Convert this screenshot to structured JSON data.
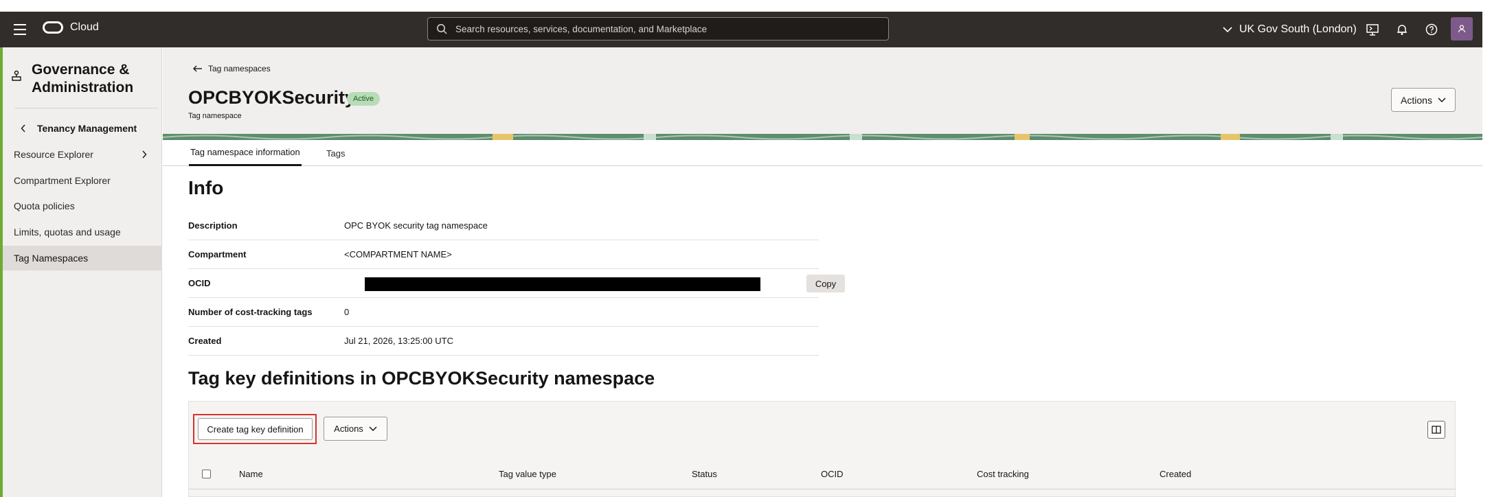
{
  "header": {
    "brand": "Cloud",
    "search_placeholder": "Search resources, services, documentation, and Marketplace",
    "region": "UK Gov South (London)"
  },
  "sidebar": {
    "title": "Governance & Administration",
    "back_label": "Tenancy Management",
    "items": [
      {
        "label": "Resource Explorer"
      },
      {
        "label": "Compartment Explorer"
      },
      {
        "label": "Quota policies"
      },
      {
        "label": "Limits, quotas and usage"
      },
      {
        "label": "Tag Namespaces"
      }
    ]
  },
  "page": {
    "back_link": "Tag namespaces",
    "title": "OPCBYOKSecurity",
    "status": "Active",
    "subtitle": "Tag namespace",
    "actions_label": "Actions"
  },
  "tabs": [
    {
      "label": "Tag namespace information"
    },
    {
      "label": "Tags"
    }
  ],
  "info": {
    "heading": "Info",
    "rows": [
      {
        "label": "Description",
        "value": "OPC BYOK security tag namespace"
      },
      {
        "label": "Compartment",
        "value": "<COMPARTMENT NAME>"
      },
      {
        "label": "OCID",
        "value": ""
      },
      {
        "label": "Number of cost-tracking tags",
        "value": "0"
      },
      {
        "label": "Created",
        "value": "Jul 21, 2026, 13:25:00 UTC"
      }
    ],
    "copy_label": "Copy"
  },
  "tag_keys": {
    "heading": "Tag key definitions in OPCBYOKSecurity namespace",
    "create_label": "Create tag key definition",
    "actions_label": "Actions",
    "columns": [
      "Name",
      "Tag value type",
      "Status",
      "OCID",
      "Cost tracking",
      "Created"
    ]
  },
  "colors": {
    "header_bg": "#312d2a",
    "accent_green": "#6faa33",
    "badge_bg": "#b8dbb8",
    "highlight_red": "#d4342c",
    "avatar": "#7e5a8a"
  }
}
